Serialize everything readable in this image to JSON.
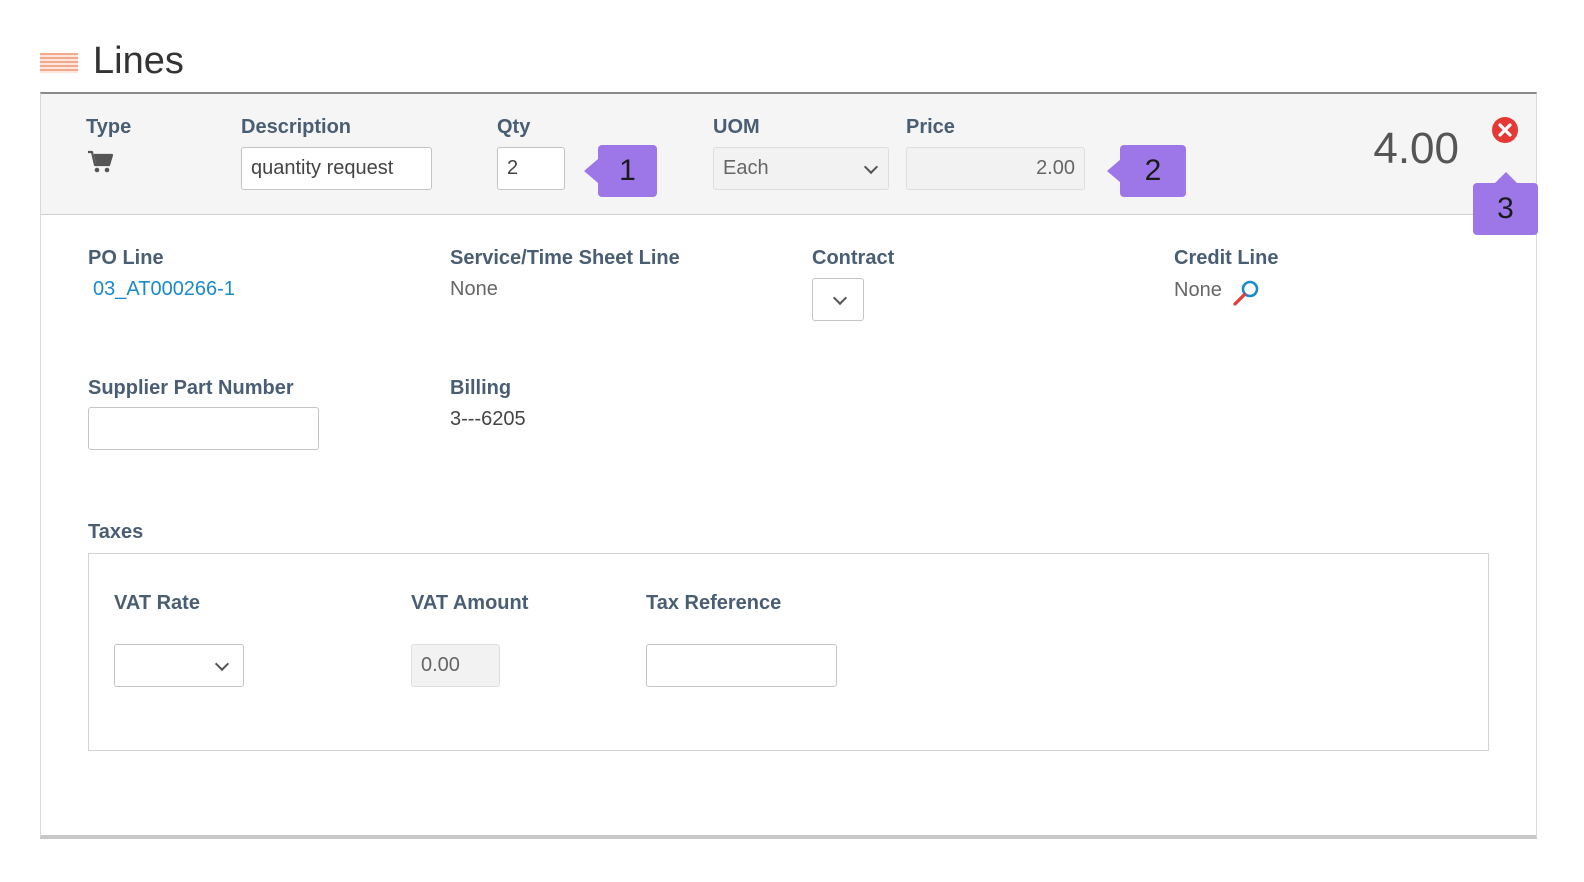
{
  "section": {
    "title": "Lines",
    "icon": "lines-stripes-icon"
  },
  "header": {
    "type_label": "Type",
    "type_icon": "shopping-cart-icon",
    "description_label": "Description",
    "description_value": "quantity request",
    "qty_label": "Qty",
    "qty_value": "2",
    "uom_label": "UOM",
    "uom_value": "Each",
    "price_label": "Price",
    "price_value": "2.00",
    "total": "4.00",
    "remove_icon": "close-circle-icon"
  },
  "callouts": {
    "one": "1",
    "two": "2",
    "three": "3"
  },
  "details": {
    "po_line_label": "PO Line",
    "po_line_value": "03_AT000266-1",
    "service_label": "Service/Time Sheet Line",
    "service_value": "None",
    "contract_label": "Contract",
    "credit_label": "Credit Line",
    "credit_value": "None",
    "supplier_part_label": "Supplier Part Number",
    "supplier_part_value": "",
    "billing_label": "Billing",
    "billing_value": "3---6205"
  },
  "taxes": {
    "title": "Taxes",
    "vat_rate_label": "VAT Rate",
    "vat_rate_value": "",
    "vat_amount_label": "VAT Amount",
    "vat_amount_value": "0.00",
    "tax_reference_label": "Tax Reference",
    "tax_reference_value": ""
  },
  "colors": {
    "accent_callout": "#9d77e8",
    "label": "#4a5e73",
    "link": "#1a8acb",
    "remove": "#e53935"
  }
}
